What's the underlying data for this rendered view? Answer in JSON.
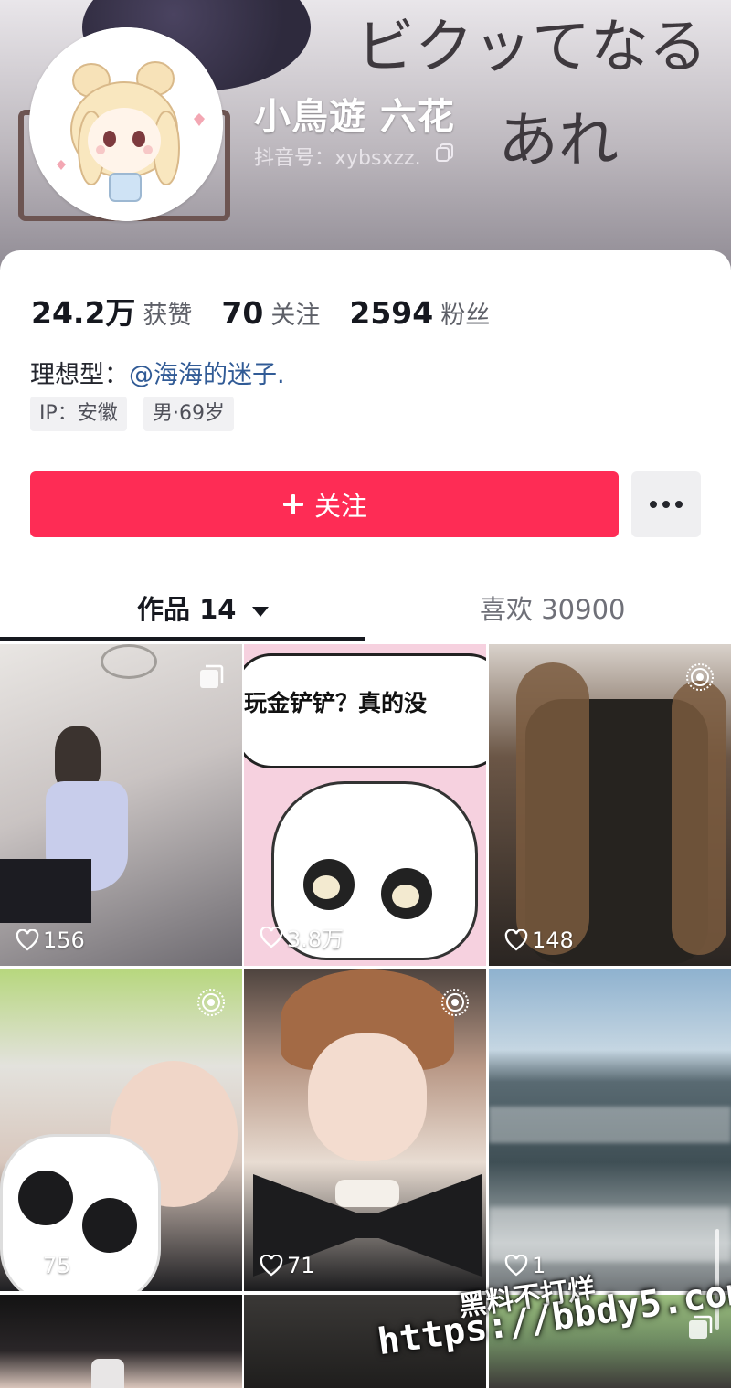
{
  "banner": {
    "doodle_text_1": "ビクッてなる",
    "doodle_text_2": "あれ"
  },
  "profile": {
    "nickname": "小鳥遊 六花",
    "douyin_id": "抖音号：xybsxzz."
  },
  "stats": [
    {
      "value": "24.2万",
      "label": "获赞"
    },
    {
      "value": "70",
      "label": "关注"
    },
    {
      "value": "2594",
      "label": "粉丝"
    }
  ],
  "bio": {
    "prefix": "理想型：",
    "mention": "@海海的迷子."
  },
  "tags": [
    "IP：安徽",
    "男·69岁"
  ],
  "actions": {
    "follow_label": "关注",
    "follow_icon": "plus-icon",
    "more_icon": "more-icon"
  },
  "tabs": {
    "works": "作品 14",
    "likes": "喜欢 30900"
  },
  "grid": [
    {
      "likes": "156",
      "badge": "multi-image-icon",
      "overlay_text": ""
    },
    {
      "likes": "3.8万",
      "badge": "",
      "overlay_text": "玩金铲铲？真的没"
    },
    {
      "likes": "148",
      "badge": "live-photo-icon",
      "overlay_text": ""
    },
    {
      "likes": "75",
      "badge": "live-photo-icon",
      "overlay_text": ""
    },
    {
      "likes": "71",
      "badge": "live-photo-icon",
      "overlay_text": ""
    },
    {
      "likes": "1",
      "badge": "",
      "overlay_text": ""
    },
    {
      "likes": "",
      "badge": "",
      "overlay_text": ""
    },
    {
      "likes": "",
      "badge": "",
      "overlay_text": ""
    },
    {
      "likes": "",
      "badge": "multi-image-icon",
      "overlay_text": ""
    }
  ],
  "watermark": {
    "line1": "黑料不打烊",
    "line2": "https://bbdy5.com"
  },
  "colors": {
    "accent": "#fe2c55",
    "mention": "#315b96"
  }
}
